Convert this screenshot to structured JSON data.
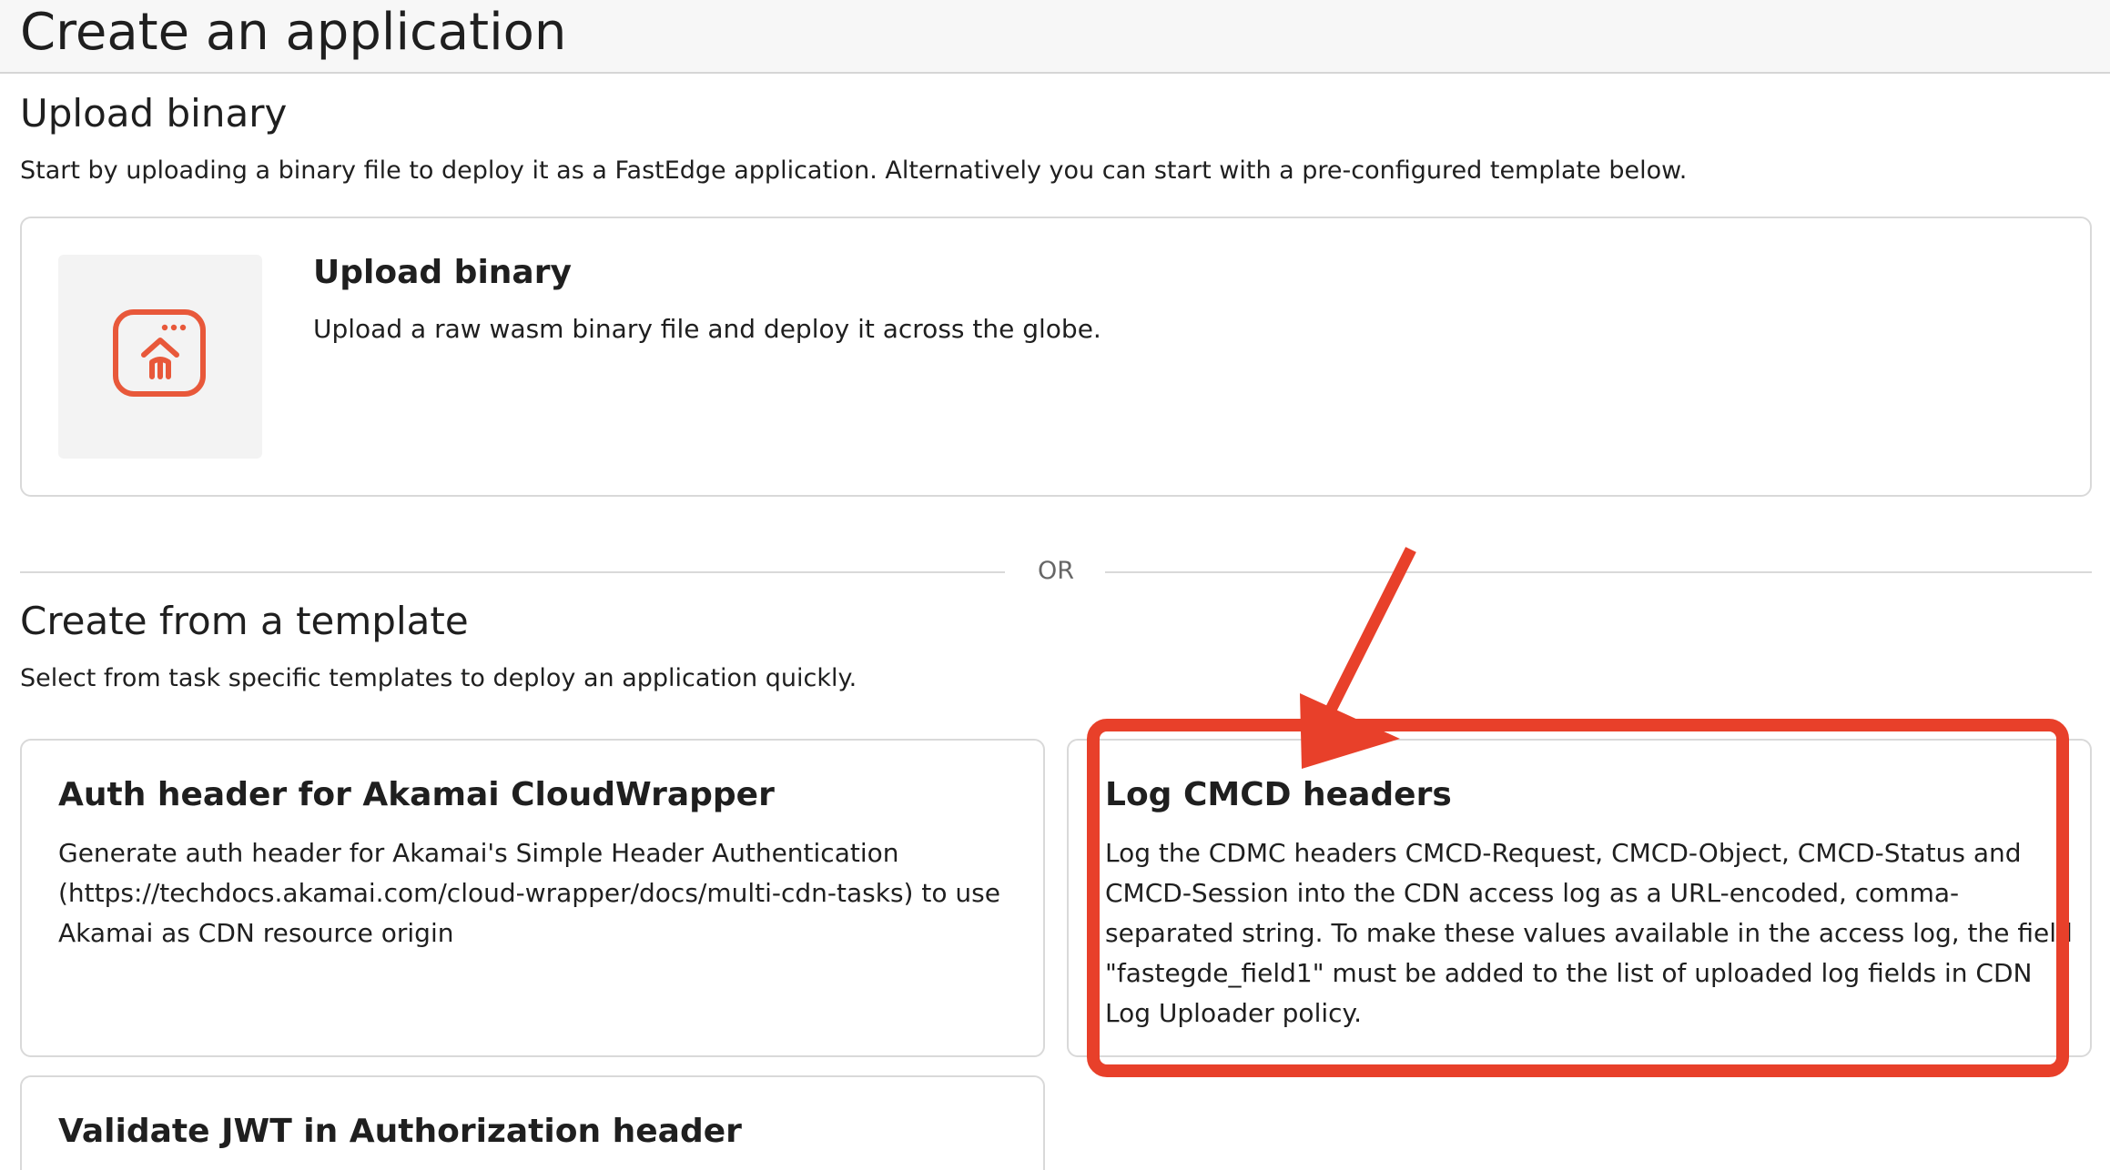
{
  "page": {
    "title": "Create an application"
  },
  "upload_section": {
    "title": "Upload binary",
    "description": "Start by uploading a binary file to deploy it as a FastEdge application. Alternatively you can start with a pre-configured template below.",
    "card": {
      "icon": "upload-file-icon",
      "title": "Upload binary",
      "description": "Upload a raw wasm binary file and deploy it across the globe."
    }
  },
  "divider": {
    "label": "OR"
  },
  "template_section": {
    "title": "Create from a template",
    "description": "Select from task specific templates to deploy an application quickly.",
    "templates": [
      {
        "title": "Auth header for Akamai CloudWrapper",
        "description": "Generate auth header for Akamai's Simple Header Authentication (https://techdocs.akamai.com/cloud-wrapper/docs/multi-cdn-tasks) to use Akamai as CDN resource origin"
      },
      {
        "title": "Log CMCD headers",
        "description": "Log the CDMC headers CMCD-Request, CMCD-Object, CMCD-Status and CMCD-Session into the CDN access log as a URL-encoded, comma-separated string. To make these values available in the access log, the field \"fastegde_field1\" must be added to the list of uploaded log fields in CDN Log Uploader policy."
      },
      {
        "title": "Validate JWT in Authorization header",
        "description": ""
      }
    ]
  },
  "colors": {
    "accent": "#e8583a",
    "annotation": "#e8402a",
    "border": "#d9d9d9",
    "text": "#1f1f1f",
    "muted": "#666666"
  }
}
